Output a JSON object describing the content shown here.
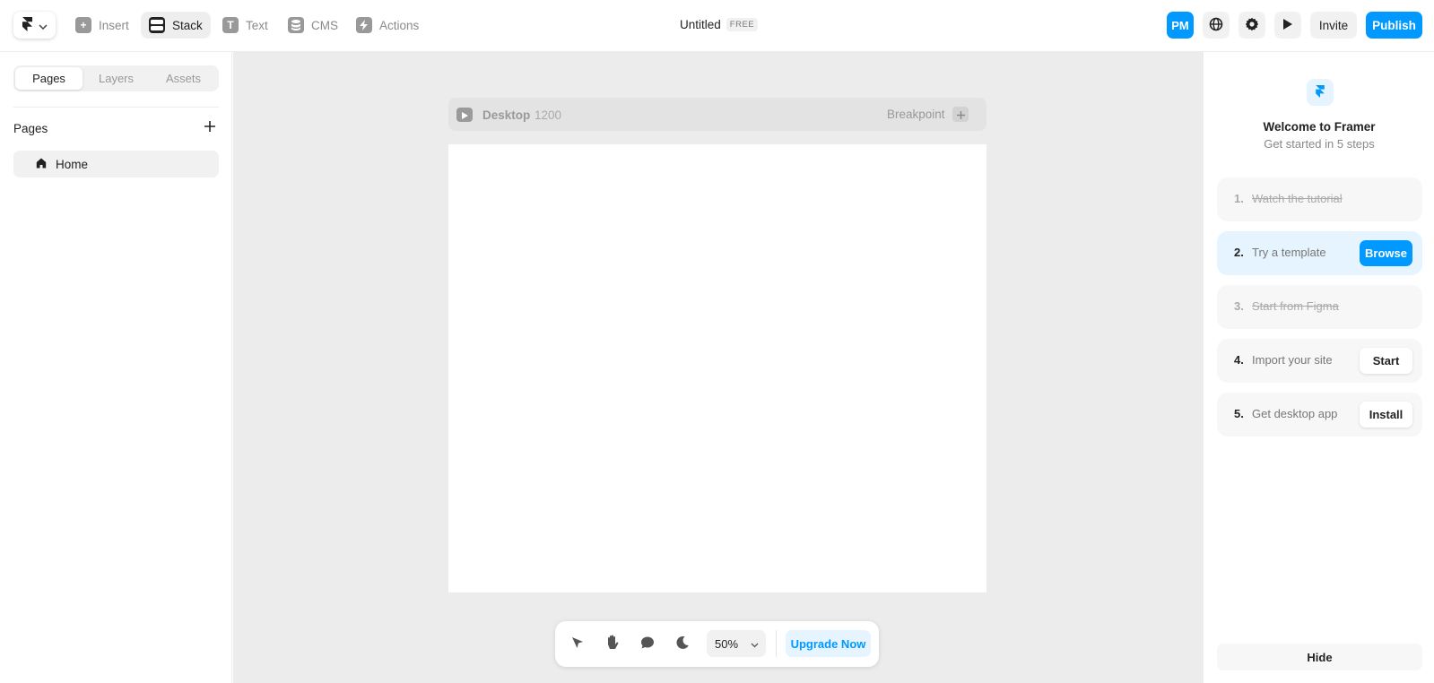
{
  "toolbar": {
    "tools": [
      {
        "label": "Insert",
        "icon": "plus-square-icon"
      },
      {
        "label": "Stack",
        "icon": "stack-icon"
      },
      {
        "label": "Text",
        "icon": "text-icon"
      },
      {
        "label": "CMS",
        "icon": "database-icon"
      },
      {
        "label": "Actions",
        "icon": "bolt-icon"
      }
    ],
    "active_tool": "Stack",
    "doc_title": "Untitled",
    "plan_badge": "FREE",
    "avatar_initials": "PM",
    "invite_label": "Invite",
    "publish_label": "Publish",
    "accent_color": "#0099ff"
  },
  "left_panel": {
    "tabs": [
      "Pages",
      "Layers",
      "Assets"
    ],
    "active_tab": "Pages",
    "section_title": "Pages",
    "pages": [
      {
        "label": "Home",
        "icon": "home-icon"
      }
    ]
  },
  "canvas": {
    "frame_name": "Desktop",
    "frame_width": "1200",
    "breakpoint_label": "Breakpoint",
    "zoom": "50%",
    "upgrade_label": "Upgrade Now"
  },
  "right_panel": {
    "title": "Welcome to Framer",
    "subtitle": "Get started in 5 steps",
    "steps": [
      {
        "num": "1.",
        "label": "Watch the tutorial",
        "done": true,
        "button": ""
      },
      {
        "num": "2.",
        "label": "Try a template",
        "done": false,
        "button": "Browse"
      },
      {
        "num": "3.",
        "label": "Start from Figma",
        "done": true,
        "button": ""
      },
      {
        "num": "4.",
        "label": "Import your site",
        "done": false,
        "button": "Start"
      },
      {
        "num": "5.",
        "label": "Get desktop app",
        "done": false,
        "button": "Install"
      }
    ],
    "hide_label": "Hide"
  }
}
